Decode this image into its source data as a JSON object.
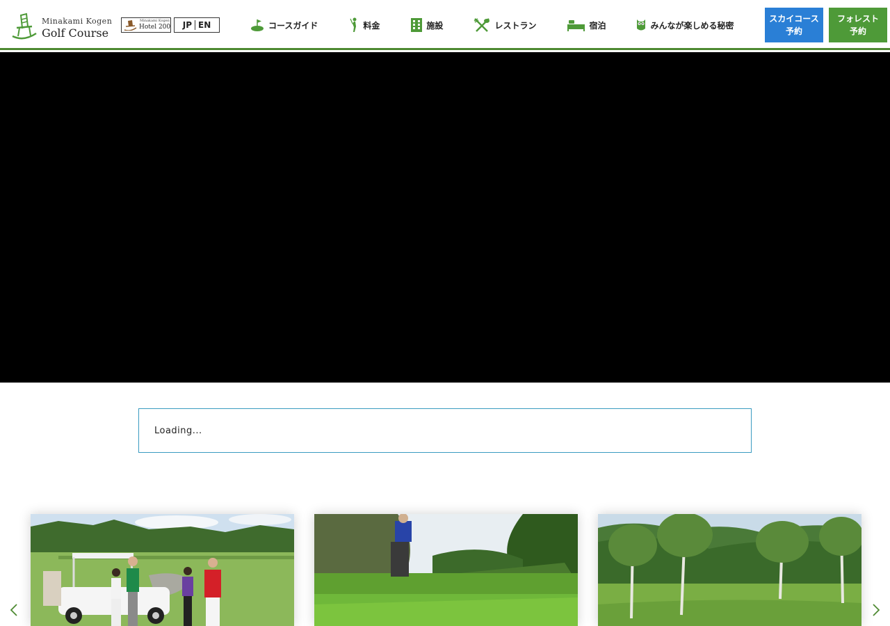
{
  "header": {
    "logo": {
      "line1": "Minakami Kogen",
      "line2": "Golf Course"
    },
    "hotel_badge": {
      "line1": "Minakami Kogen",
      "line2": "Hotel 200"
    },
    "lang": {
      "jp": "JP",
      "en": "EN"
    },
    "nav": [
      {
        "label": "コースガイド",
        "icon": "golf-flag-icon"
      },
      {
        "label": "料金",
        "icon": "golfer-icon"
      },
      {
        "label": "施設",
        "icon": "building-icon"
      },
      {
        "label": "レストラン",
        "icon": "utensils-icon"
      },
      {
        "label": "宿泊",
        "icon": "bed-icon"
      },
      {
        "label": "みんなが楽しめる秘密",
        "icon": "owl-icon"
      }
    ],
    "reserve": [
      {
        "line1": "スカイコース",
        "line2": "予約",
        "color": "#2a7fd6"
      },
      {
        "line1": "フォレスト",
        "line2": "予約",
        "color": "#4e9a38"
      }
    ]
  },
  "hero": {
    "background": "#000000"
  },
  "loading": {
    "text": "Loading..."
  },
  "carousel": {
    "cards": [
      {
        "image": "golfers-with-cart"
      },
      {
        "image": "golfer-putting-on-green"
      },
      {
        "image": "birch-trees-fairway"
      }
    ],
    "prev_icon": "chevron-left-icon",
    "next_icon": "chevron-right-icon"
  },
  "colors": {
    "accent_green": "#4e8a32",
    "sky_blue": "#2a7fd6",
    "forest_green": "#4e9a38",
    "loading_border": "#3a9bc0"
  }
}
